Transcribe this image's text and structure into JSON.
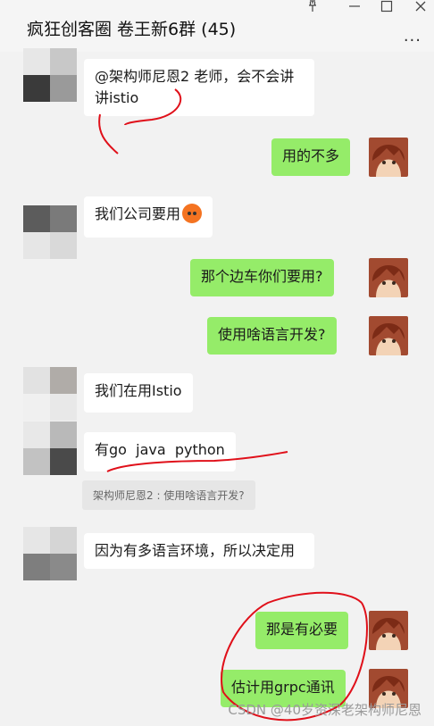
{
  "header": {
    "title": "疯狂创客圈 卷王新6群 (45)",
    "pin_icon": "pin-icon",
    "min_icon": "minimize-icon",
    "max_icon": "maximize-icon",
    "close_icon": "close-icon",
    "more_label": "..."
  },
  "messages": [
    {
      "side": "left",
      "text": "@架构师尼恩2 老师，会不会讲讲istio"
    },
    {
      "side": "right",
      "text": "用的不多"
    },
    {
      "side": "left",
      "text": "我们公司要用",
      "emoji": "sweat-emoji"
    },
    {
      "side": "right",
      "text": "那个边车你们要用?"
    },
    {
      "side": "right",
      "text": "使用啥语言开发?"
    },
    {
      "side": "left",
      "text": "我们在用Istio"
    },
    {
      "side": "left",
      "text": "有go  java  python"
    },
    {
      "side": "quote",
      "text": "架构师尼恩2 : 使用啥语言开发?"
    },
    {
      "side": "left",
      "text": "因为有多语言环境，所以决定用"
    },
    {
      "side": "right",
      "text": "那是有必要"
    },
    {
      "side": "right",
      "text": "估计用grpc通讯"
    }
  ],
  "watermark": "CSDN @40岁资深老架构师尼恩",
  "colors": {
    "right_bubble": "#95ec69",
    "left_bubble": "#ffffff",
    "background": "#f2f2f2",
    "annotation": "#e0101a"
  }
}
